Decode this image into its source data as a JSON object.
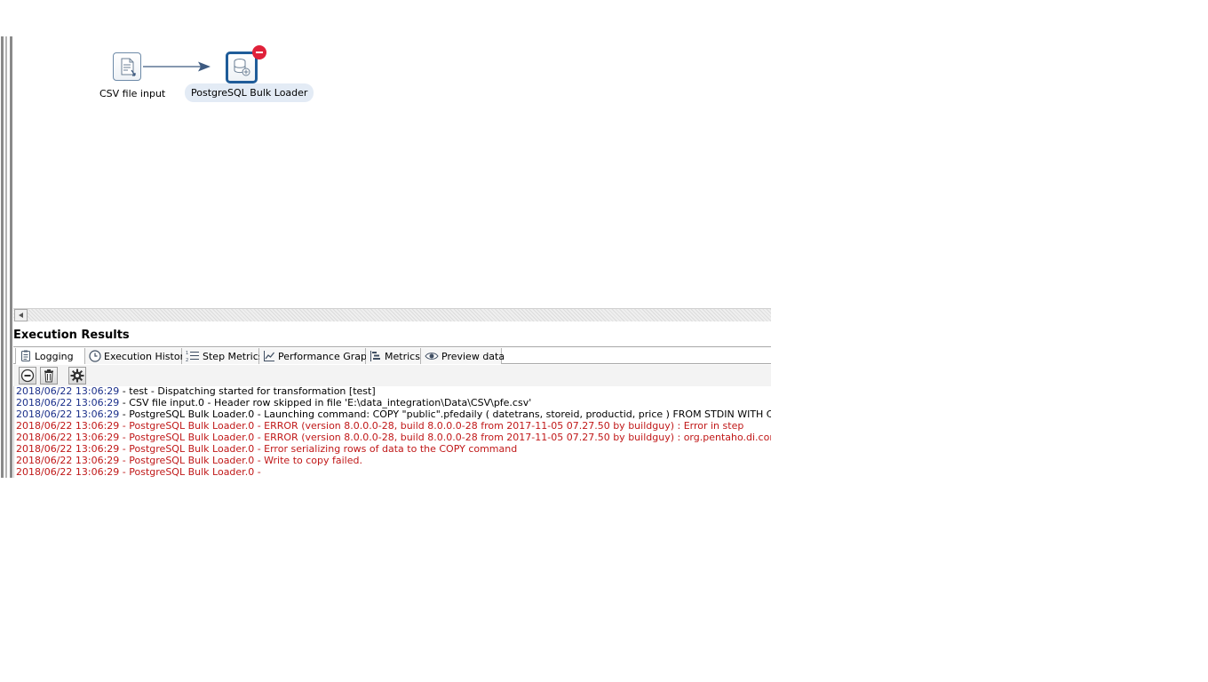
{
  "canvas": {
    "steps": [
      {
        "label": "CSV file input",
        "icon": "csv-file-icon",
        "selected": false,
        "error": false
      },
      {
        "label": "PostgreSQL Bulk Loader",
        "icon": "database-icon",
        "selected": true,
        "error": true
      }
    ]
  },
  "execution": {
    "title": "Execution Results",
    "tabs": [
      {
        "label": "Logging",
        "icon": "logging-icon",
        "active": true
      },
      {
        "label": "Execution History",
        "icon": "clock-icon",
        "active": false
      },
      {
        "label": "Step Metrics",
        "icon": "list-icon",
        "active": false
      },
      {
        "label": "Performance Graph",
        "icon": "graph-icon",
        "active": false
      },
      {
        "label": "Metrics",
        "icon": "metrics-icon",
        "active": false
      },
      {
        "label": "Preview data",
        "icon": "eye-icon",
        "active": false
      }
    ],
    "toolbar": {
      "stop_icon": "stop-icon",
      "clear_icon": "trash-icon",
      "settings_icon": "gear-icon"
    },
    "log_lines": [
      {
        "time": "2018/06/22 13:06:29",
        "text": " - test - Dispatching started for transformation [test]",
        "level": "info"
      },
      {
        "time": "2018/06/22 13:06:29",
        "text": " - CSV file input.0 - Header row skipped in file 'E:\\data_integration\\Data\\CSV\\pfe.csv'",
        "level": "info"
      },
      {
        "time": "2018/06/22 13:06:29",
        "text": " - PostgreSQL Bulk Loader.0 - Launching command: COPY \"public\".pfedaily ( datetrans, storeid, productid, price )  FROM STDIN WITH CSV DELIMITER AS '|'",
        "level": "info"
      },
      {
        "time": "2018/06/22 13:06:29",
        "text": " - PostgreSQL Bulk Loader.0 - ERROR (version 8.0.0.0-28, build 8.0.0.0-28 from 2017-11-05 07.27.50 by buildguy) : Error in step",
        "level": "error"
      },
      {
        "time": "2018/06/22 13:06:29",
        "text": " - PostgreSQL Bulk Loader.0 - ERROR (version 8.0.0.0-28, build 8.0.0.0-28 from 2017-11-05 07.27.50 by buildguy) : org.pentaho.di.core.exception.KettleE",
        "level": "error"
      },
      {
        "time": "2018/06/22 13:06:29",
        "text": " - PostgreSQL Bulk Loader.0 - Error serializing rows of data to the COPY command",
        "level": "error"
      },
      {
        "time": "2018/06/22 13:06:29",
        "text": " - PostgreSQL Bulk Loader.0 - Write to copy failed.",
        "level": "error"
      },
      {
        "time": "2018/06/22 13:06:29",
        "text": " - PostgreSQL Bulk Loader.0 - ",
        "level": "error"
      }
    ]
  },
  "colors": {
    "timestamp": "#1a2f8a",
    "error": "#c01818",
    "selected_border": "#1f5c99",
    "error_badge": "#e0213a",
    "hop_arrow": "#3d5a80"
  }
}
